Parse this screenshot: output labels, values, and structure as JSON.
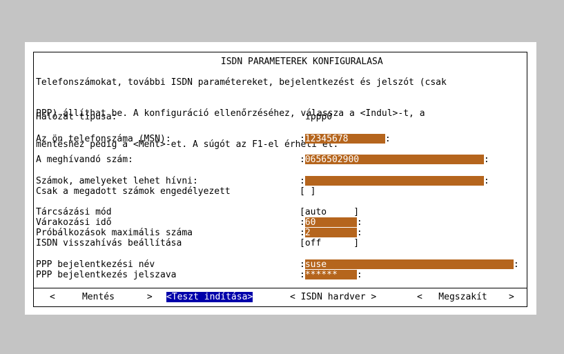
{
  "dialog": {
    "title": "ISDN PARAMETEREK KONFIGURALASA",
    "intro_lines": [
      "Telefonszámokat, további ISDN paramétereket, bejelentkezést és jelszót (csak",
      "PPP) állíthat be. A konfiguráció ellenőrzéséhez, válassza a <Indul>-t, a",
      "mentéshez pedig a <Ment>-et. A súgót az F1-el érheti el."
    ]
  },
  "fields": {
    "network_type_label": "Hálózat típusa:",
    "network_type_value": "ippp0",
    "msn_label": "Az ön telefonszáma (MSN):",
    "msn_value": "12345678",
    "dial_label": "A meghívandó szám:",
    "dial_value": "0656502900",
    "allowed_label": "Számok, amelyeket lehet hívni:",
    "allowed_value": "",
    "only_allowed_label": "Csak a megadott számok engedélyezett",
    "only_allowed_checkbox": "[ ]",
    "dial_mode_label": "Tárcsázási mód",
    "dial_mode_value": "[auto     ]",
    "wait_label": "Várakozási idő",
    "wait_value": "60",
    "retries_label": "Próbálkozások maximális száma",
    "retries_value": "2",
    "callback_label": "ISDN visszahívás beállítása",
    "callback_value": "[off      ]",
    "ppp_login_label": "PPP bejelentkezési név",
    "ppp_login_value": "suse",
    "ppp_password_label": "PPP bejelentkezés jelszava",
    "ppp_password_value": "******"
  },
  "buttons": {
    "save": "<     Mentés      >",
    "test": "<Teszt indítása>",
    "hardware": "< ISDN hardver >",
    "cancel": "<   Megszakít    >"
  }
}
